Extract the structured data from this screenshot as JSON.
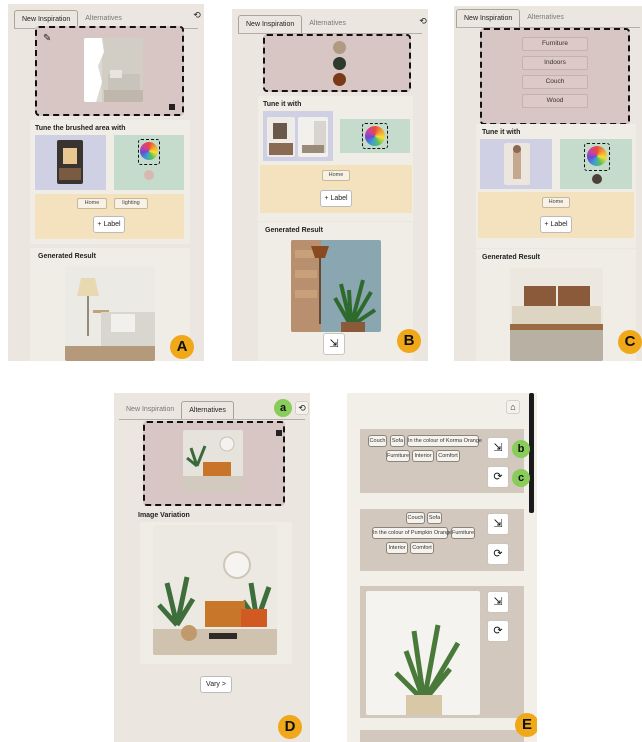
{
  "tabs": {
    "new_inspiration": "New Inspiration",
    "alternatives": "Alternatives"
  },
  "panel_a": {
    "badge": "A",
    "heading_tune": "Tune the brushed area with",
    "chips": [
      "Home",
      "lighting"
    ],
    "label_button": "+ Label",
    "heading_result": "Generated Result"
  },
  "panel_b": {
    "badge": "B",
    "palette": [
      "#b09a82",
      "#2d3b2e",
      "#7a3a18"
    ],
    "heading_tune": "Tune it with",
    "chips": [
      "Home"
    ],
    "label_button": "+ Label",
    "heading_result": "Generated Result"
  },
  "panel_c": {
    "badge": "C",
    "keywords": [
      "Furniture",
      "Indoors",
      "Couch",
      "Wood"
    ],
    "heading_tune": "Tune it with",
    "chips": [
      "Home"
    ],
    "label_button": "+ Label",
    "heading_result": "Generated Result"
  },
  "panel_d": {
    "badge": "D",
    "marker": "a",
    "heading_variation": "Image Variation",
    "vary_button": "Vary >"
  },
  "panel_e": {
    "badge": "E",
    "marker_b": "b",
    "marker_c": "c",
    "card1_tags": [
      "Couch",
      "Sofa",
      "In the colour of Korma Orange",
      "Furniture",
      "Interior",
      "Comfort"
    ],
    "card2_tags": [
      "Couch",
      "Sofa",
      "In the colour of Pumpkin Orange",
      "Furniture",
      "Interior",
      "Comfort"
    ]
  },
  "colors": {
    "panel_bg": "#ebe7e0",
    "brush_area": "#d7c6c4",
    "tune_purple": "#cfd0e4",
    "tune_green": "#c5dccd",
    "tune_yellow": "#f3e2bd",
    "badge": "#f0a818",
    "marker": "#88cc5a"
  }
}
